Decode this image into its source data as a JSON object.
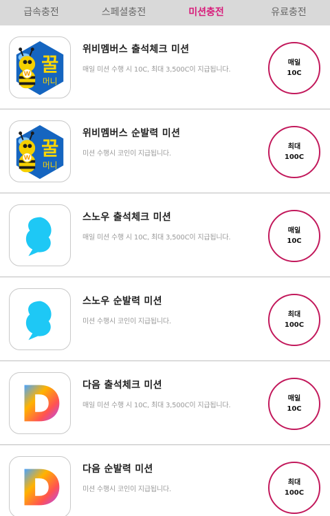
{
  "tabs": [
    {
      "label": "급속충전",
      "active": false
    },
    {
      "label": "스페셜충전",
      "active": false
    },
    {
      "label": "미션충전",
      "active": true
    },
    {
      "label": "유료충전",
      "active": false
    }
  ],
  "missions": [
    {
      "icon": "kkul-money-icon",
      "icon_text": "꿀",
      "icon_sub": "머니",
      "badge_letter": "W",
      "title": "위비멤버스 출석체크 미션",
      "desc": "매일 미션 수행 시 10C, 최대 3,500C이 지급됩니다.",
      "reward_line1": "매일",
      "reward_line2": "10C"
    },
    {
      "icon": "kkul-money-icon",
      "icon_text": "꿀",
      "icon_sub": "머니",
      "badge_letter": "W",
      "title": "위비멤버스 순발력 미션",
      "desc": "미션 수행시 코인이 지급됩니다.",
      "reward_line1": "최대",
      "reward_line2": "100C"
    },
    {
      "icon": "snow-icon",
      "title": "스노우 출석체크 미션",
      "desc": "매일 미션 수행 시 10C, 최대 3,500C이 지급됩니다.",
      "reward_line1": "매일",
      "reward_line2": "10C"
    },
    {
      "icon": "snow-icon",
      "title": "스노우 순발력 미션",
      "desc": "미션 수행시 코인이 지급됩니다.",
      "reward_line1": "최대",
      "reward_line2": "100C"
    },
    {
      "icon": "daum-icon",
      "title": "다음 출석체크 미션",
      "desc": "매일 미션 수행 시 10C, 최대 3,500C이 지급됩니다.",
      "reward_line1": "매일",
      "reward_line2": "10C"
    },
    {
      "icon": "daum-icon",
      "title": "다음 순발력 미션",
      "desc": "미션 수행시 코인이 지급됩니다.",
      "reward_line1": "최대",
      "reward_line2": "100C"
    }
  ],
  "colors": {
    "accent": "#d81b7a",
    "tabbar_bg": "#d9d9d9",
    "snow": "#1ec8f5",
    "kkul_blue": "#1565c0",
    "kkul_yellow": "#ffd600"
  }
}
